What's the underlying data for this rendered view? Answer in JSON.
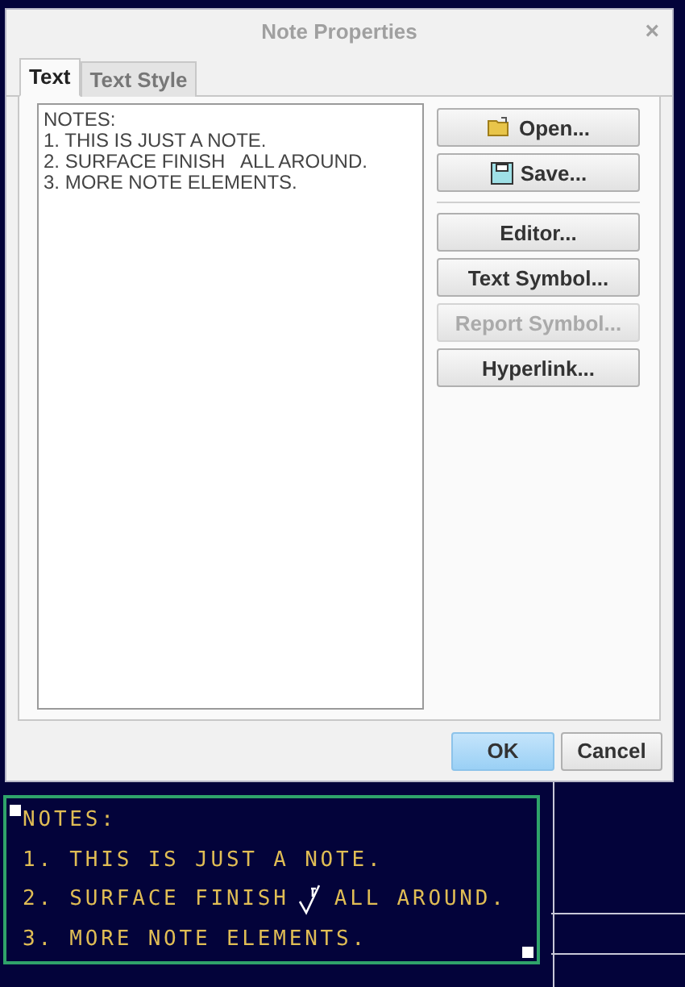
{
  "dialog": {
    "title": "Note Properties",
    "close": "×",
    "tabs": [
      {
        "label": "Text",
        "selected": true
      },
      {
        "label": "Text Style",
        "selected": false
      }
    ],
    "text_lines": [
      "NOTES:",
      "1. THIS IS JUST A NOTE.",
      "2. SURFACE FINISH   ALL AROUND.",
      "3. MORE NOTE ELEMENTS."
    ],
    "side_buttons": [
      {
        "label": "Open...",
        "disabled": false
      },
      {
        "label": "Save...",
        "disabled": false
      },
      {
        "kind": "separator"
      },
      {
        "label": "Editor...",
        "disabled": false
      },
      {
        "label": "Text Symbol...",
        "disabled": false
      },
      {
        "label": "Report Symbol...",
        "disabled": true
      },
      {
        "label": "Hyperlink...",
        "disabled": false
      }
    ],
    "footer_buttons": [
      {
        "label": "OK",
        "default": true
      },
      {
        "label": "Cancel",
        "default": false
      }
    ]
  },
  "cad_note": {
    "selected": true,
    "lines": [
      [
        {
          "kind": "text",
          "text": "NOTES:"
        }
      ],
      [
        {
          "kind": "text",
          "text": "1. THIS IS JUST A NOTE."
        }
      ],
      [
        {
          "kind": "text",
          "text": "2. SURFACE FINISH"
        },
        {
          "kind": "symbol"
        },
        {
          "kind": "text",
          "text": "ALL AROUND."
        }
      ],
      [
        {
          "kind": "text",
          "text": "3. MORE NOTE ELEMENTS."
        }
      ]
    ]
  }
}
